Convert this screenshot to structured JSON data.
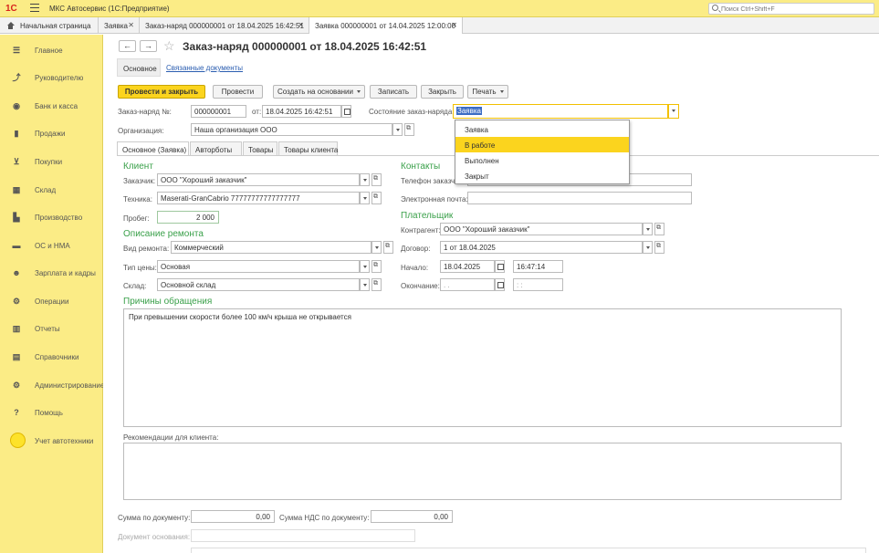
{
  "app": {
    "logo": "1С",
    "title": "МКС Автосервис  (1С:Предприятие)",
    "search_placeholder": "Поиск Ctrl+Shift+F"
  },
  "window_tabs": [
    {
      "label": "Начальная страница"
    },
    {
      "label": "Заявка"
    },
    {
      "label": "Заказ-наряд 000000001 от 18.04.2025 16:42:51"
    },
    {
      "label": "Заявка 000000001 от 14.04.2025 12:00:00"
    }
  ],
  "sidebar": {
    "items": [
      {
        "label": "Главное",
        "icon": "☰"
      },
      {
        "label": "Руководителю",
        "icon": "⤴"
      },
      {
        "label": "Банк и касса",
        "icon": "◉"
      },
      {
        "label": "Продажи",
        "icon": "▮"
      },
      {
        "label": "Покупки",
        "icon": "⊻"
      },
      {
        "label": "Склад",
        "icon": "▦"
      },
      {
        "label": "Производство",
        "icon": "▙"
      },
      {
        "label": "ОС и НМА",
        "icon": "▬"
      },
      {
        "label": "Зарплата и кадры",
        "icon": "☻"
      },
      {
        "label": "Операции",
        "icon": "⚙"
      },
      {
        "label": "Отчеты",
        "icon": "▥"
      },
      {
        "label": "Справочники",
        "icon": "▤"
      },
      {
        "label": "Администрирование",
        "icon": "⚙"
      },
      {
        "label": "Помощь",
        "icon": "?"
      },
      {
        "label": "Учет автотехники",
        "icon": ""
      }
    ]
  },
  "doc": {
    "title": "Заказ-наряд 000000001 от 18.04.2025 16:42:51",
    "tabs": {
      "main": "Основное",
      "related": "Связанные документы"
    },
    "buttons": {
      "post_close": "Провести и закрыть",
      "post": "Провести",
      "create_based": "Создать на основании",
      "write": "Записать",
      "close": "Закрыть",
      "print": "Печать"
    },
    "number_label": "Заказ-наряд №:",
    "number": "000000001",
    "date_label": "от:",
    "date": "18.04.2025 16:42:51",
    "state_label": "Состояние заказ-наряда:",
    "state": "Заявка",
    "org_label": "Организация:",
    "org": "Наша организация ООО"
  },
  "state_dropdown": {
    "options": [
      "Заявка",
      "В работе",
      "Выполнен",
      "Закрыт"
    ],
    "selected": "В работе"
  },
  "inner_tabs": [
    "Основное (Заявка)",
    "Авторботы",
    "Товары",
    "Товары клиента"
  ],
  "client": {
    "section": "Клиент",
    "customer_label": "Заказчик:",
    "customer": "ООО \"Хороший заказчик\"",
    "vehicle_label": "Техника:",
    "vehicle": "Maserati-GranCabrio 77777777777777777",
    "mileage_label": "Пробег:",
    "mileage": "2 000"
  },
  "repair": {
    "section": "Описание ремонта",
    "type_label": "Вид ремонта:",
    "type": "Коммерческий",
    "price_type_label": "Тип цены:",
    "price_type": "Основая",
    "warehouse_label": "Склад:",
    "warehouse": "Основной склад"
  },
  "contacts": {
    "section": "Контакты",
    "phone_label": "Телефон заказчика:",
    "email_label": "Электронная почта:"
  },
  "payer": {
    "section": "Плательщик",
    "counterparty_label": "Контрагент:",
    "counterparty": "ООО \"Хороший заказчик\"",
    "contract_label": "Договор:",
    "contract": "1 от 18.04.2025",
    "start_label": "Начало:",
    "start_date": "18.04.2025",
    "start_time": "16:47:14",
    "end_label": "Окончание:",
    "end_date": " .  .",
    "end_time": " :  :"
  },
  "reasons": {
    "section": "Причины обращения",
    "text": "При превышении скорости более 100 км/ч крыша не открывается"
  },
  "recommendations": {
    "label": "Рекомендации для клиента:"
  },
  "totals": {
    "sum_label": "Сумма по документу:",
    "sum": "0,00",
    "vat_label": "Сумма НДС по документу:",
    "vat": "0,00",
    "base_doc_label": "Документ основания:"
  }
}
